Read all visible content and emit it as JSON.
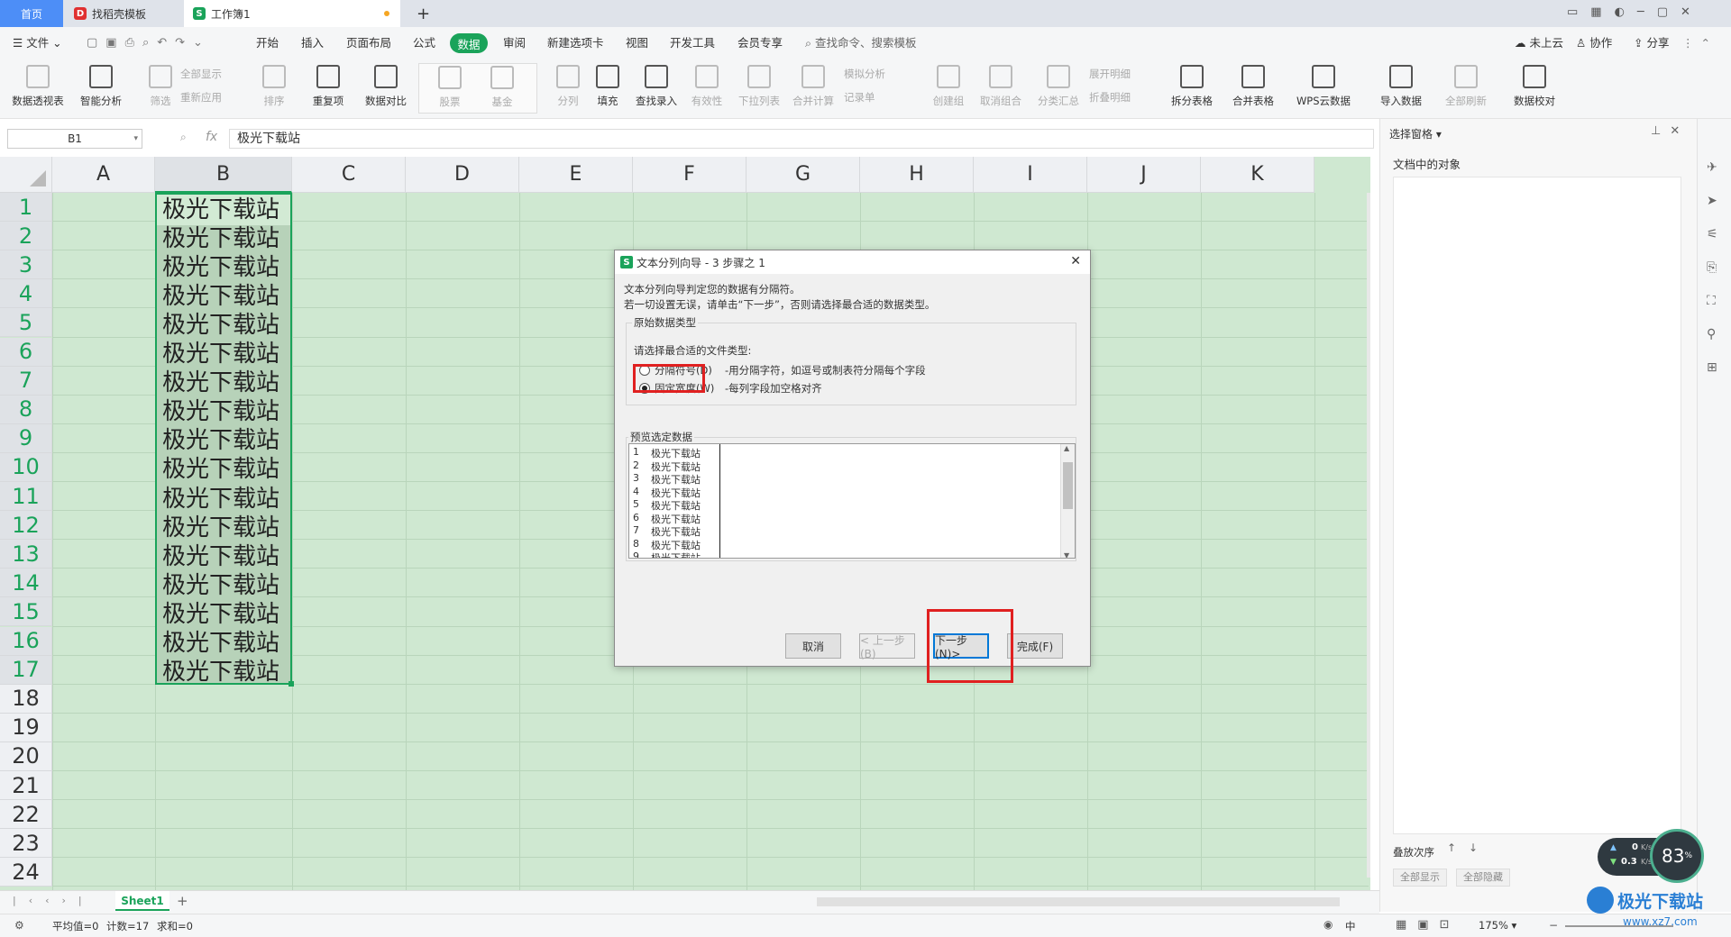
{
  "tabs": [
    {
      "label": "首页"
    },
    {
      "label": "找稻壳模板"
    },
    {
      "label": "工作簿1"
    }
  ],
  "menu": [
    "文件",
    "开始",
    "插入",
    "页面布局",
    "公式",
    "数据",
    "审阅",
    "新建选项卡",
    "视图",
    "开发工具",
    "会员专享"
  ],
  "search_placeholder": "查找命令、搜索模板",
  "top_right": {
    "cloud": "未上云",
    "collab": "协作",
    "share": "分享"
  },
  "ribbon": {
    "pivot": "数据透视表",
    "smart": "智能分析",
    "filter": "筛选",
    "showall": "全部显示",
    "reapply": "重新应用",
    "sort": "排序",
    "dup": "重复项",
    "compare": "数据对比",
    "stock": "股票",
    "fund": "基金",
    "split": "分列",
    "fill": "填充",
    "lookup": "查找录入",
    "valid": "有效性",
    "dropdown": "下拉列表",
    "consolidate": "合并计算",
    "simanalysis": "模拟分析",
    "record": "记录单",
    "group": "创建组",
    "ungroup": "取消组合",
    "subtotal": "分类汇总",
    "expand": "展开明细",
    "collapse": "折叠明细",
    "splittable": "拆分表格",
    "mergetable": "合并表格",
    "wpscloud": "WPS云数据",
    "import": "导入数据",
    "refreshall": "全部刷新",
    "check": "数据校对"
  },
  "formula": {
    "namebox": "B1",
    "fx": "fx",
    "content": "极光下载站"
  },
  "columns": [
    "A",
    "B",
    "C",
    "D",
    "E",
    "F",
    "G",
    "H",
    "I",
    "J",
    "K"
  ],
  "rows": [
    "1",
    "2",
    "3",
    "4",
    "5",
    "6",
    "7",
    "8",
    "9",
    "10",
    "11",
    "12",
    "13",
    "14",
    "15",
    "16",
    "17",
    "18",
    "19",
    "20",
    "21",
    "22",
    "23",
    "24"
  ],
  "cell_text": "极光下载站",
  "pane": {
    "title": "选择窗格",
    "objects": "文档中的对象",
    "order": "叠放次序",
    "showall": "全部显示",
    "hideall": "全部隐藏"
  },
  "dialog": {
    "title": "文本分列向导 - 3 步骤之 1",
    "line1": "文本分列向导判定您的数据有分隔符。",
    "line2": "若一切设置无误，请单击“下一步”，否则请选择最合适的数据类型。",
    "group_label": "原始数据类型",
    "choose": "请选择最合适的文件类型:",
    "opt1": "分隔符号(D)",
    "opt1_desc": "-用分隔字符，如逗号或制表符分隔每个字段",
    "opt2": "固定宽度(W)",
    "opt2_desc": "-每列字段加空格对齐",
    "preview_label": "预览选定数据",
    "preview_rows": [
      "1",
      "2",
      "3",
      "4",
      "5",
      "6",
      "7",
      "8",
      "9"
    ],
    "preview_text": "极光下载站",
    "cancel": "取消",
    "prev": "< 上一步(B)",
    "next": "下一步(N)>",
    "finish": "完成(F)"
  },
  "sheet": {
    "name": "Sheet1"
  },
  "status": {
    "avg": "平均值=0",
    "count": "计数=17",
    "sum": "求和=0",
    "zoom": "175%",
    "lang": "中"
  },
  "net": {
    "up": "0",
    "down": "0.3",
    "unit": "K/s",
    "percent": "83",
    "pct": "%"
  },
  "watermark": "极光下载站",
  "watermark_url": "www.xz7.com"
}
